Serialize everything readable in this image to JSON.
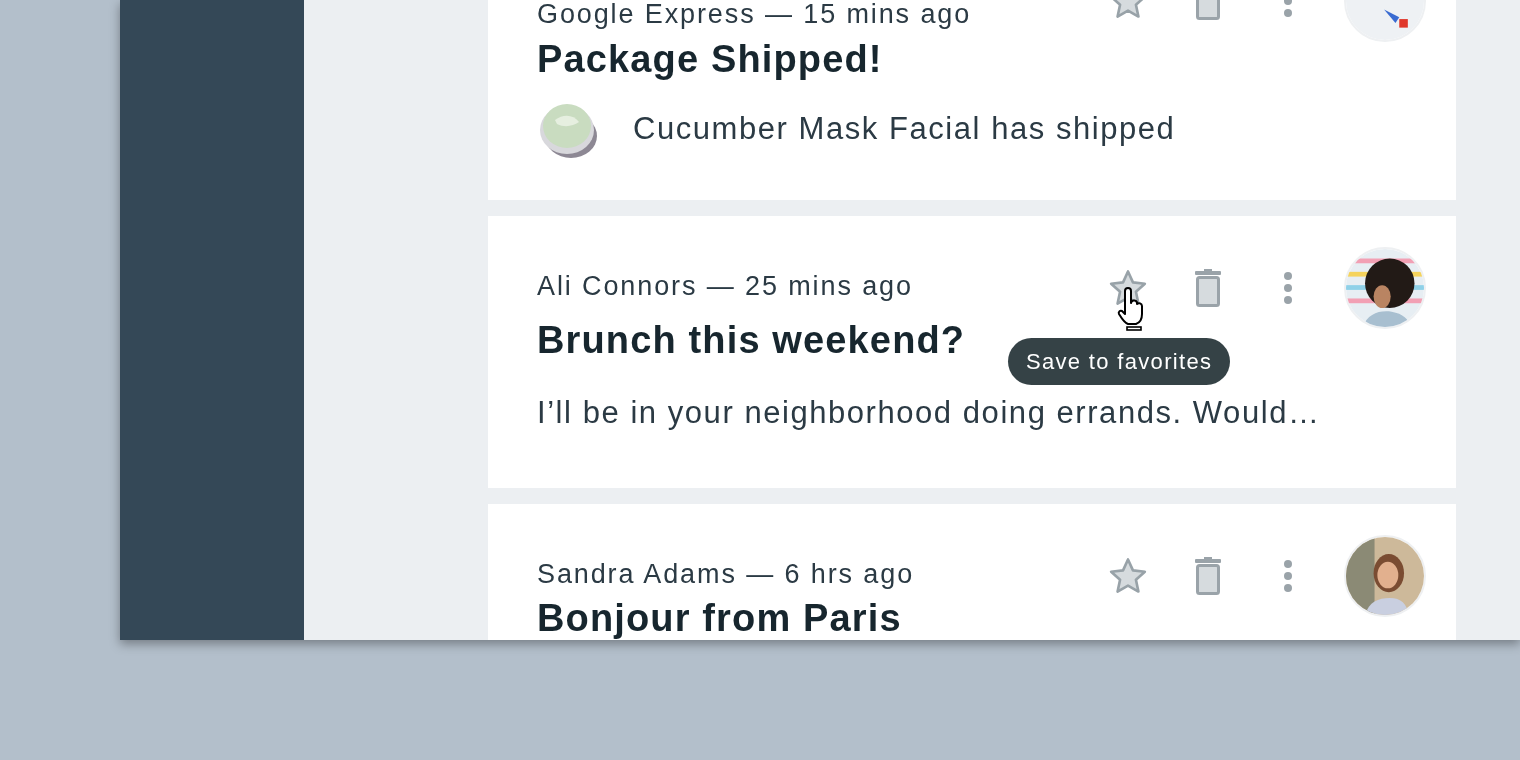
{
  "emails": [
    {
      "sender_line": "Google Express — 15 mins ago",
      "subject": "Package Shipped!",
      "preview": "Cucumber Mask Facial has shipped",
      "starred": false
    },
    {
      "sender_line": "Ali Connors — 25 mins ago",
      "subject": "Brunch this weekend?",
      "preview": "I’ll be in your neighborhood doing errands. Would…",
      "starred": false,
      "tooltip": "Save to favorites"
    },
    {
      "sender_line": "Sandra Adams — 6 hrs ago",
      "subject": "Bonjour from Paris",
      "starred": false
    }
  ]
}
